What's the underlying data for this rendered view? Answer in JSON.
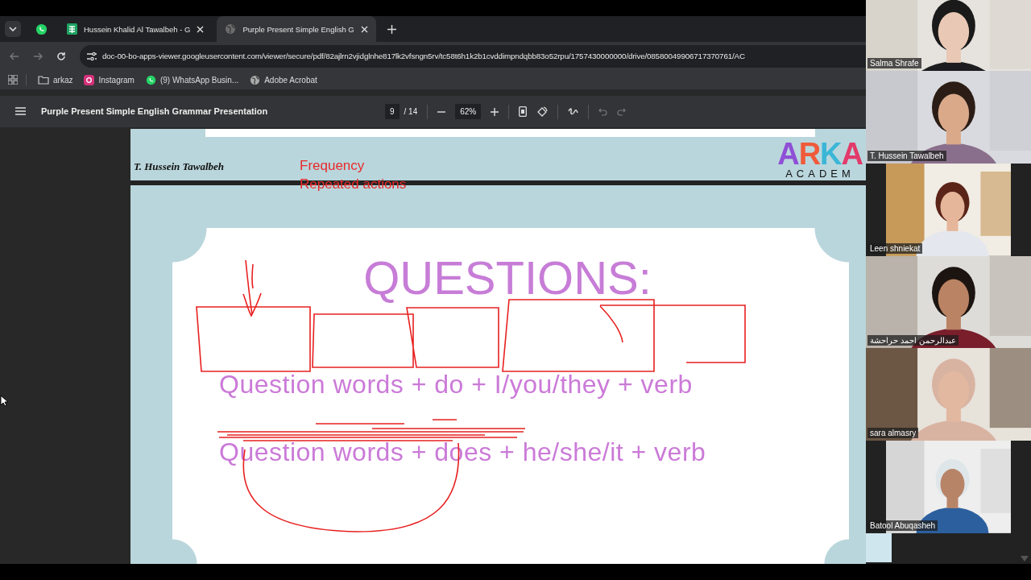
{
  "browser": {
    "tabs": [
      {
        "kind": "sheet",
        "label": "Hussein Khalid Al Tawalbeh - G",
        "selected": false
      },
      {
        "kind": "globe",
        "label": "Purple Present Simple English G",
        "selected": true
      }
    ],
    "address": "doc-00-bo-apps-viewer.googleusercontent.com/viewer/secure/pdf/82ajlrn2vjidglnhe817lk2vfsngn5rv/tc58t6h1k2b1cvddimpndqbb83o52rpu/1757430000000/drive/08580049906717370761/AC",
    "bookmarks": [
      {
        "kind": "folder",
        "label": "arkaz"
      },
      {
        "kind": "instagram",
        "label": "Instagram"
      },
      {
        "kind": "whatsapp",
        "label": "(9) WhatsApp Busin..."
      },
      {
        "kind": "globe",
        "label": "Adobe Acrobat"
      }
    ]
  },
  "viewer": {
    "title": "Purple Present Simple English Grammar Presentation",
    "page": "9",
    "page_total": "/ 14",
    "zoom": "62%"
  },
  "slide": {
    "author": "T. Hussein Tawalbeh",
    "notes": [
      "Frequency",
      "Repeated actions"
    ],
    "logo": "ARKA",
    "logo_sub": "ACADEM",
    "heading": "QUESTIONS:",
    "lines": [
      "Question words + do + I/you/they + verb",
      "Question words + does + he/she/it + verb"
    ]
  },
  "participants": [
    {
      "name": "Salma Shrafe",
      "letterboxed": false
    },
    {
      "name": "T. Hussein Tawalbeh",
      "letterboxed": false
    },
    {
      "name": "Leen shniekat",
      "letterboxed": true
    },
    {
      "name": "عبدالرحمن احمد حراحشة",
      "letterboxed": false
    },
    {
      "name": "sara almasry",
      "letterboxed": false
    },
    {
      "name": "Batool Abuqasheh",
      "letterboxed": true
    }
  ]
}
